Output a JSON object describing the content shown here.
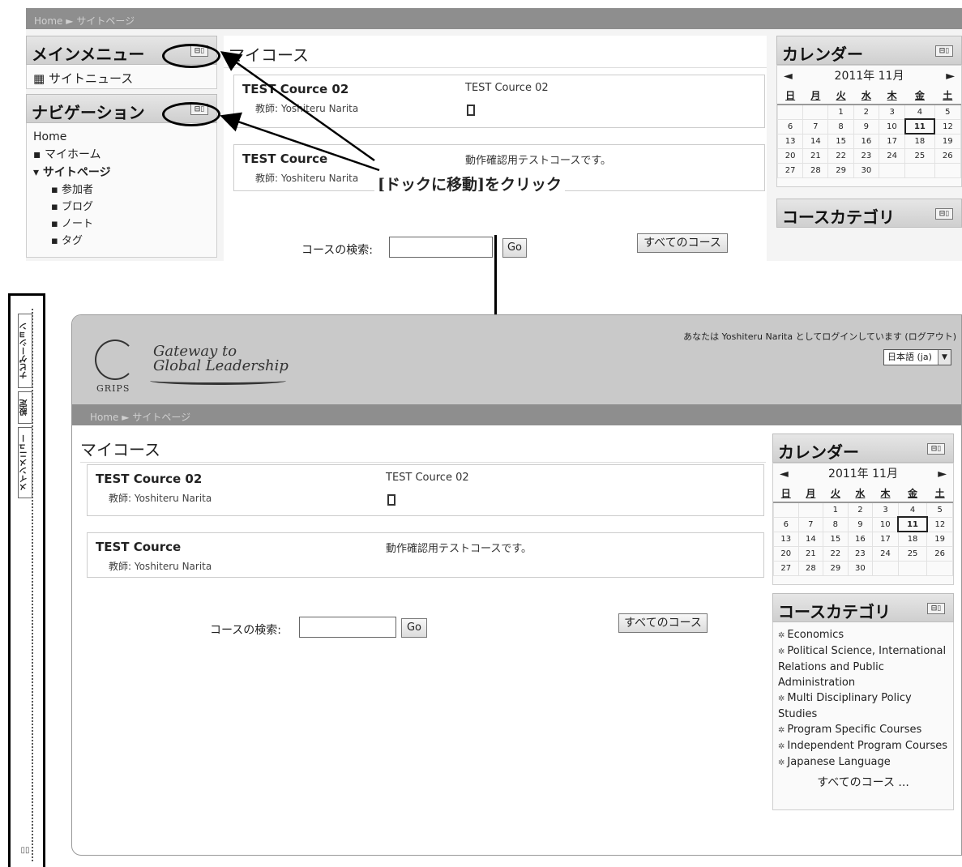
{
  "breadcrumb": {
    "home": "Home",
    "sep": "►",
    "current": "サイトページ"
  },
  "blocks": {
    "main_menu": {
      "title": "メインメニュー",
      "item": "サイトニュース"
    },
    "navigation": {
      "title": "ナビゲーション",
      "home": "Home",
      "items": [
        "マイホーム",
        "サイトページ"
      ],
      "subitems": [
        "参加者",
        "ブログ",
        "ノート",
        "タグ"
      ]
    },
    "dock_icon": "⊟▯"
  },
  "main": {
    "title": "マイコース",
    "courses": [
      {
        "name": "TEST Cource 02",
        "teacher": "教師: Yoshiteru Narita",
        "summary": "TEST Cource 02"
      },
      {
        "name": "TEST Cource",
        "teacher": "教師: Yoshiteru Narita",
        "summary": "動作確認用テストコースです。"
      }
    ],
    "search_label": "コースの検索:",
    "go_label": "Go",
    "all_courses_label": "すべてのコース"
  },
  "calendar": {
    "title": "カレンダー",
    "month": "2011年 11月",
    "prev": "◄",
    "next": "►",
    "weekdays": [
      "日",
      "月",
      "火",
      "水",
      "木",
      "金",
      "土"
    ],
    "weeks": [
      [
        "",
        "",
        "1",
        "2",
        "3",
        "4",
        "5"
      ],
      [
        "6",
        "7",
        "8",
        "9",
        "10",
        "11",
        "12"
      ],
      [
        "13",
        "14",
        "15",
        "16",
        "17",
        "18",
        "19"
      ],
      [
        "20",
        "21",
        "22",
        "23",
        "24",
        "25",
        "26"
      ],
      [
        "27",
        "28",
        "29",
        "30",
        "",
        "",
        ""
      ]
    ],
    "today": "11"
  },
  "categories": {
    "title": "コースカテゴリ",
    "items": [
      "Economics",
      "Political Science, International Relations and Public Administration",
      "Multi Disciplinary Policy Studies",
      "Program Specific Courses",
      "Independent Program Courses",
      "Japanese Language"
    ],
    "all": "すべてのコース ..."
  },
  "annotation": {
    "instruction": "[ドックに移動]をクリック"
  },
  "header": {
    "logo_line1": "Gateway to",
    "logo_line2": "Global Leadership",
    "logo_org": "GRIPS",
    "login_info": "あなたは Yoshiteru Narita としてログインしています (ログアウト)",
    "language": "日本語 (ja)"
  },
  "dock": {
    "tabs": [
      "ナビゲーション",
      "設定",
      "メインメニュー"
    ],
    "icon": "▯▯"
  }
}
